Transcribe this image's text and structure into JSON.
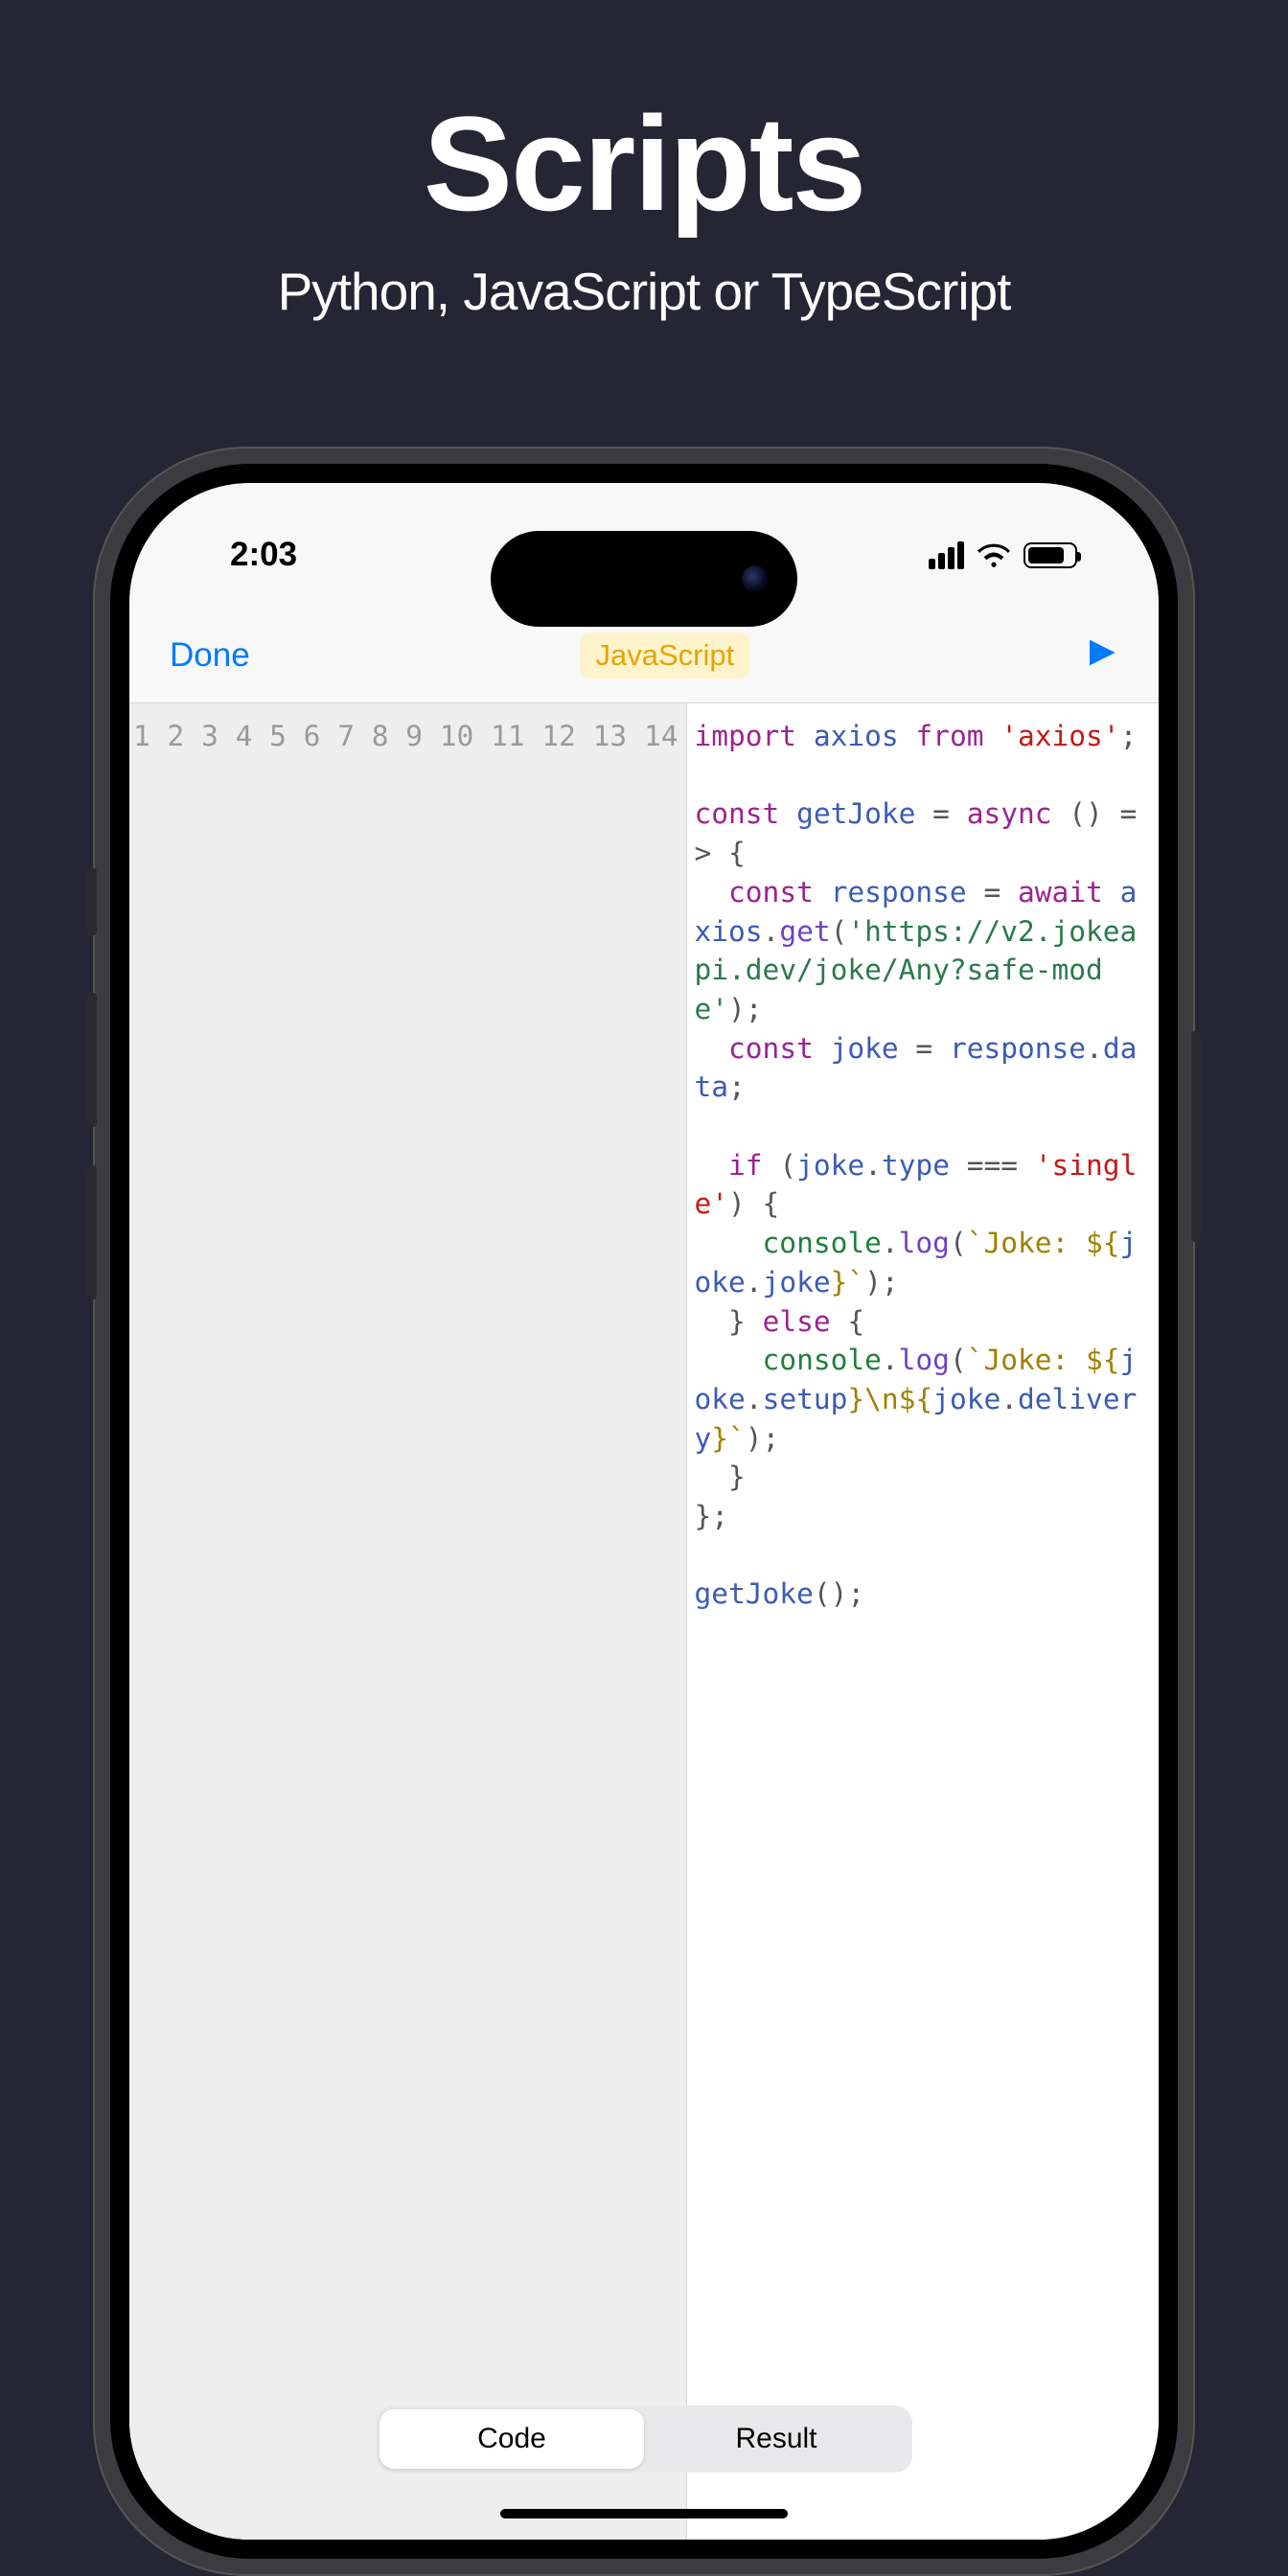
{
  "hero": {
    "title": "Scripts",
    "subtitle": "Python, JavaScript or TypeScript"
  },
  "status": {
    "time": "2:03"
  },
  "nav": {
    "done": "Done",
    "language": "JavaScript"
  },
  "editor": {
    "line_numbers": [
      "1",
      "2",
      "3",
      "4",
      "5",
      "6",
      "7",
      "8",
      "9",
      "10",
      "11",
      "12",
      "13",
      "14"
    ]
  },
  "code": {
    "l1": {
      "import": "import",
      "axios": "axios",
      "from": "from",
      "str": "'axios'",
      "semi": ";"
    },
    "l3": {
      "const": "const",
      "name": "getJoke",
      "eq": " = ",
      "async": "async",
      "arrow": " () => {"
    },
    "l4a": {
      "const": "const",
      "name": "response",
      "eq": " = ",
      "await": "await"
    },
    "l4b": {
      "obj": "axios",
      "dot": ".",
      "mth": "get",
      "open": "(",
      "url": "'https://v2.jokeapi.dev/joke/Any?safe-mode'",
      "close": ");"
    },
    "l5": {
      "const": "const",
      "name": "joke",
      "eq": " = ",
      "exp": "response",
      "dot": ".",
      "prop": "data",
      "semi": ";"
    },
    "l7": {
      "if": "if",
      "open": " (",
      "obj": "joke",
      "dot": ".",
      "prop": "type",
      "op": " === ",
      "str": "'single'",
      "close": ") {"
    },
    "l8": {
      "obj": "console",
      "dot": ".",
      "mth": "log",
      "open": "(",
      "tplopen": "`Joke: ",
      "varopen": "${",
      "exp": "joke",
      "dot2": ".",
      "prop": "joke",
      "varclose": "}",
      "tplclose": "`",
      "close": ");"
    },
    "l9": {
      "brace": "  } ",
      "else": "else",
      "open": " {"
    },
    "l10": {
      "obj": "console",
      "dot": ".",
      "mth": "log",
      "open": "(",
      "tplopen": "`Joke: ",
      "varopen": "${",
      "exp": "joke",
      "dot2": ".",
      "prop": "setup",
      "varclose": "}",
      "nl": "\\n",
      "varopen2": "${",
      "exp2": "joke",
      "dot3": ".",
      "prop2": "delivery",
      "varclose2": "}",
      "tplclose": "`",
      "close": ");"
    },
    "l11": "  }",
    "l12": "};",
    "l14": {
      "call": "getJoke",
      "paren": "();"
    }
  },
  "seg": {
    "code": "Code",
    "result": "Result"
  }
}
